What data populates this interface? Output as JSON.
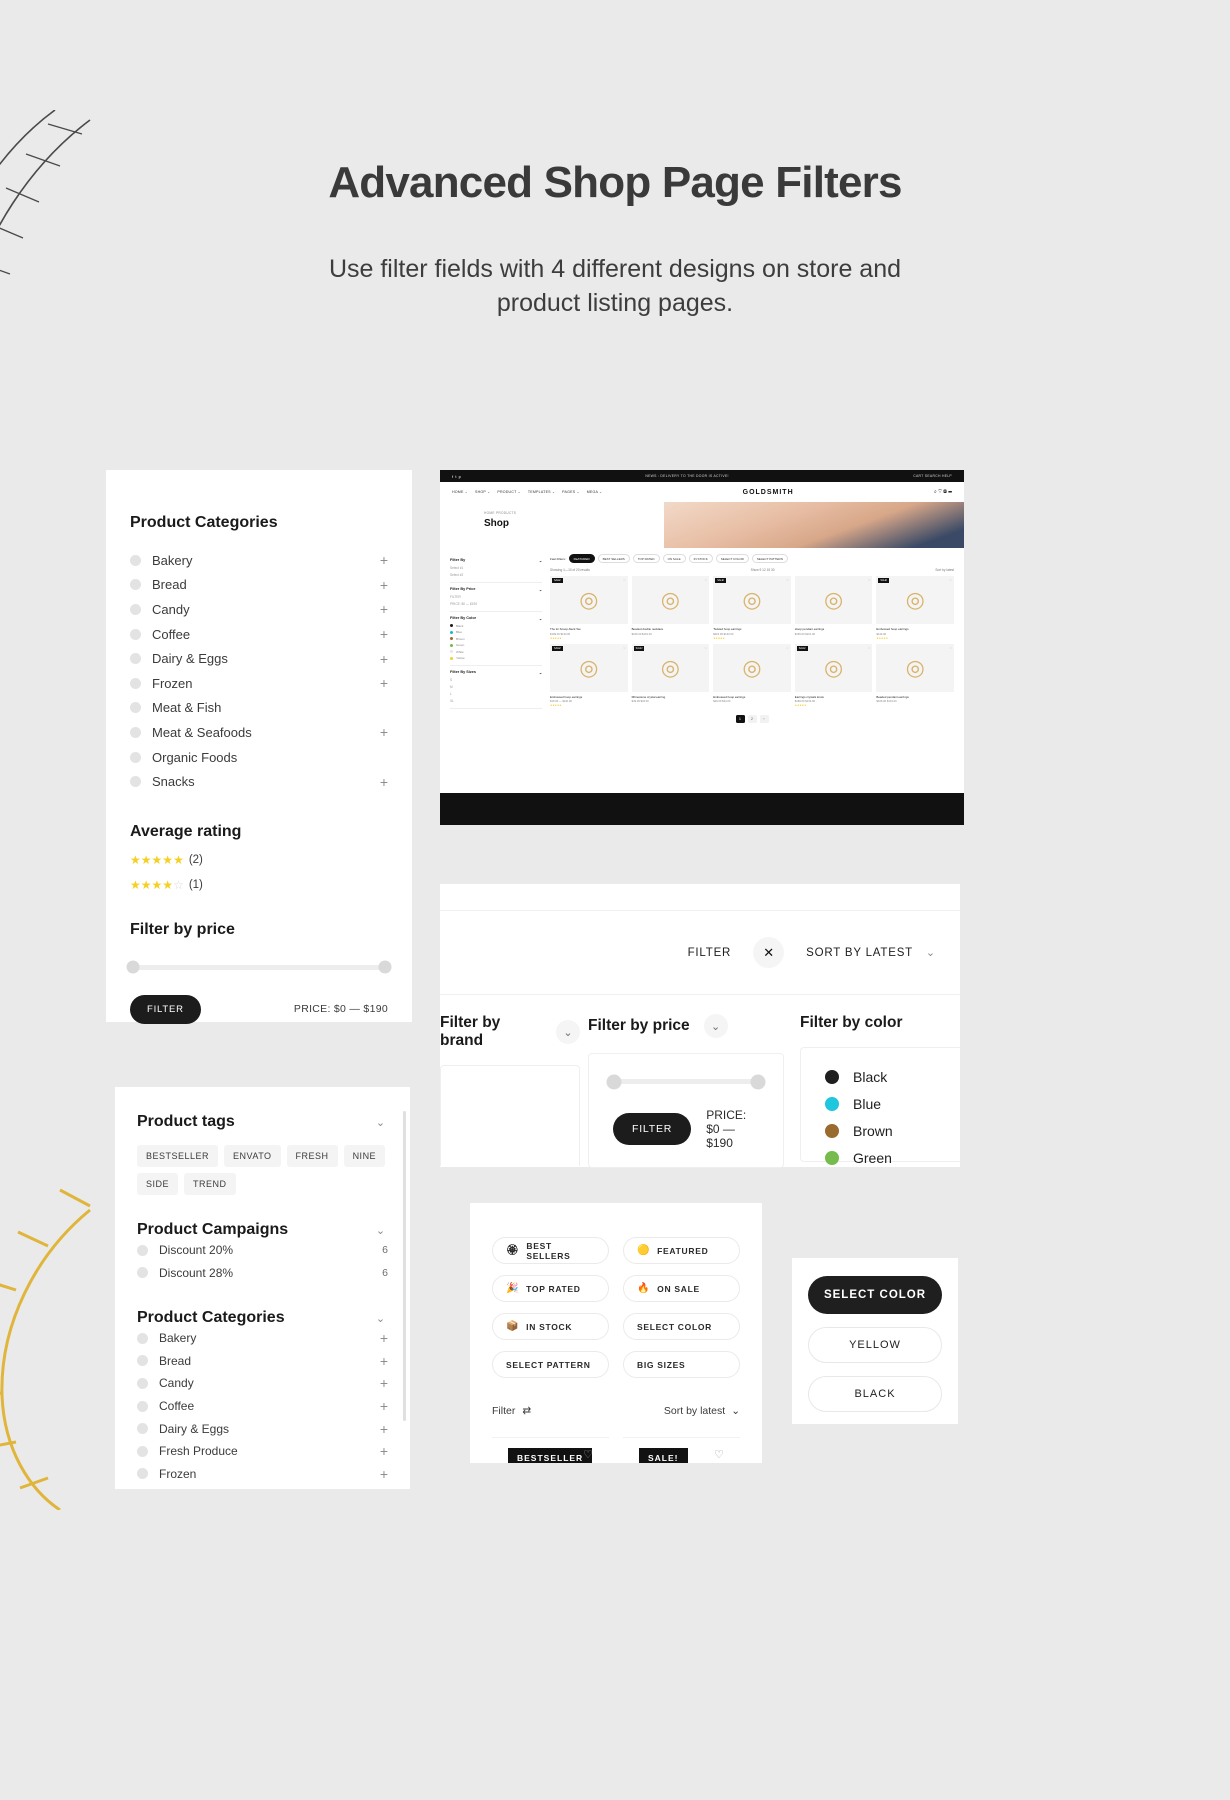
{
  "hero": {
    "title": "Advanced Shop Page Filters",
    "subtitle": "Use filter fields with 4 different designs on store and product listing pages."
  },
  "sidebar": {
    "categories_title": "Product Categories",
    "categories": [
      {
        "label": "Bakery",
        "expand": "+"
      },
      {
        "label": "Bread",
        "expand": "+"
      },
      {
        "label": "Candy",
        "expand": "+"
      },
      {
        "label": "Coffee",
        "expand": "+"
      },
      {
        "label": "Dairy & Eggs",
        "expand": "+"
      },
      {
        "label": "Frozen",
        "expand": "+"
      },
      {
        "label": "Meat & Fish",
        "expand": ""
      },
      {
        "label": "Meat & Seafoods",
        "expand": "+"
      },
      {
        "label": "Organic Foods",
        "expand": ""
      },
      {
        "label": "Snacks",
        "expand": "+"
      }
    ],
    "rating_title": "Average rating",
    "ratings": [
      {
        "stars_on": 5,
        "count": "(2)"
      },
      {
        "stars_on": 4,
        "count": "(1)"
      }
    ],
    "price_title": "Filter by price",
    "filter_button": "FILTER",
    "price_text": "PRICE: $0 — $190"
  },
  "tags_card": {
    "tags_title": "Product tags",
    "tags": [
      "BESTSELLER",
      "ENVATO",
      "FRESH",
      "NINE",
      "SIDE",
      "TREND"
    ],
    "campaigns_title": "Product Campaigns",
    "campaigns": [
      {
        "label": "Discount 20%",
        "count": "6"
      },
      {
        "label": "Discount 28%",
        "count": "6"
      }
    ],
    "categories_title": "Product Categories",
    "categories": [
      {
        "label": "Bakery",
        "expand": "+"
      },
      {
        "label": "Bread",
        "expand": "+"
      },
      {
        "label": "Candy",
        "expand": "+"
      },
      {
        "label": "Coffee",
        "expand": "+"
      },
      {
        "label": "Dairy & Eggs",
        "expand": "+"
      },
      {
        "label": "Fresh Produce",
        "expand": "+"
      },
      {
        "label": "Frozen",
        "expand": "+"
      }
    ]
  },
  "shop": {
    "topbar_center": "NEWS : DELIVERY TO THE DOOR IS ACTIVE!",
    "topbar_right": "CART   SEARCH   HELP",
    "nav": [
      "HOME",
      "SHOP",
      "PRODUCT",
      "TEMPLATES",
      "PAGES",
      "MEGA"
    ],
    "brand": "GOLDSMITH",
    "breadcrumb": "HOME   PRODUCTS",
    "page_title": "Shop",
    "side_blocks": [
      {
        "title": "Filter By",
        "lines": [
          "Select #1",
          "Select #2"
        ]
      },
      {
        "title": "Filter By Price",
        "lines": [
          "FILTER",
          "PRICE: $0 — $190"
        ]
      },
      {
        "title": "Filter By Color",
        "lines": []
      },
      {
        "title": "Filter By Sizes",
        "lines": [
          "S",
          "M",
          "L",
          "XL"
        ]
      }
    ],
    "colors": [
      {
        "name": "Black",
        "hex": "#1b1b1b"
      },
      {
        "name": "Blue",
        "hex": "#19b6d8"
      },
      {
        "name": "Brown",
        "hex": "#9a6b34"
      },
      {
        "name": "Green",
        "hex": "#72bb4a"
      },
      {
        "name": "White",
        "hex": "#e6e6e6"
      },
      {
        "name": "Yellow",
        "hex": "#f2cf30"
      }
    ],
    "pills": [
      "Fast Filters:",
      "FEATURED",
      "BEST SELLERS",
      "TOP RATED",
      "ON SALE",
      "IN STOCK",
      "SELECT COLOR",
      "SELECT PATTERN"
    ],
    "results": "Showing 1—10 of 20 results",
    "view": "Show  9  12  15  30",
    "sort": "Sort by latest",
    "products_row1": [
      {
        "badge": "SALE!",
        "title": "The tin Scoop-Neck Tee",
        "price": "$199.00  $133.00",
        "rating": "★★★★★"
      },
      {
        "badge": "",
        "title": "Beaded double necklace",
        "price": "$166.00  $101.00",
        "rating": ""
      },
      {
        "badge": "SALE!",
        "title": "Twisted hoop earrings",
        "price": "$215.00  $133.00",
        "rating": "★★★★★"
      },
      {
        "badge": "",
        "title": "Hoop pendant earrings",
        "price": "$166.00  $101.00",
        "rating": ""
      },
      {
        "badge": "SALE!",
        "title": "Embossed hoop earrings",
        "price": "$144.00",
        "rating": "★★★★★"
      }
    ],
    "products_row2": [
      {
        "badge": "SALE!",
        "title": "Embossed hoop earrings",
        "price": "$19.00 — $110.00",
        "rating": "★★★★★"
      },
      {
        "badge": "SALE!",
        "title": "Rhinestone crystal earring",
        "price": "$49.00  $34.00",
        "rating": ""
      },
      {
        "badge": "",
        "title": "Embossed hoop earrings",
        "price": "$49.00  $34.00",
        "rating": ""
      },
      {
        "badge": "SALE!",
        "title": "Earrings crystals knots",
        "price": "$199.00  $133.00",
        "rating": "★★★★★"
      },
      {
        "badge": "",
        "title": "Beaded pendant earrings",
        "price": "$166.00  $101.00",
        "rating": ""
      }
    ],
    "pages": [
      "1",
      "2",
      "›"
    ]
  },
  "filter_bar": {
    "filter_label": "FILTER",
    "close_icon": "✕",
    "sort_label": "SORT BY LATEST",
    "columns": [
      {
        "title": "Filter by brand"
      },
      {
        "title": "Filter by price"
      },
      {
        "title": "Filter by color"
      }
    ],
    "price_filter_button": "FILTER",
    "price_text": "PRICE: $0 — $190",
    "colors": [
      {
        "name": "Black",
        "hex": "#1f1f1f"
      },
      {
        "name": "Blue",
        "hex": "#1ec6de"
      },
      {
        "name": "Brown",
        "hex": "#9a6b2e"
      },
      {
        "name": "Green",
        "hex": "#76bb4d"
      }
    ]
  },
  "pills_card": {
    "pills": [
      {
        "label": "BEST SELLERS",
        "emoji": "🏵"
      },
      {
        "label": "FEATURED",
        "emoji": "🟡"
      },
      {
        "label": "TOP RATED",
        "emoji": "🎉"
      },
      {
        "label": "ON SALE",
        "emoji": "🔥"
      },
      {
        "label": "IN STOCK",
        "emoji": "📦"
      },
      {
        "label": "SELECT COLOR",
        "emoji": ""
      },
      {
        "label": "SELECT PATTERN",
        "emoji": ""
      },
      {
        "label": "BIG SIZES",
        "emoji": ""
      }
    ],
    "filter_label": "Filter",
    "sort_label": "Sort by latest",
    "mini_cards": [
      {
        "badge": "BESTSELLER"
      },
      {
        "badge": "SALE!"
      }
    ]
  },
  "color_card": {
    "select_label": "SELECT COLOR",
    "options": [
      "YELLOW",
      "BLACK"
    ]
  }
}
